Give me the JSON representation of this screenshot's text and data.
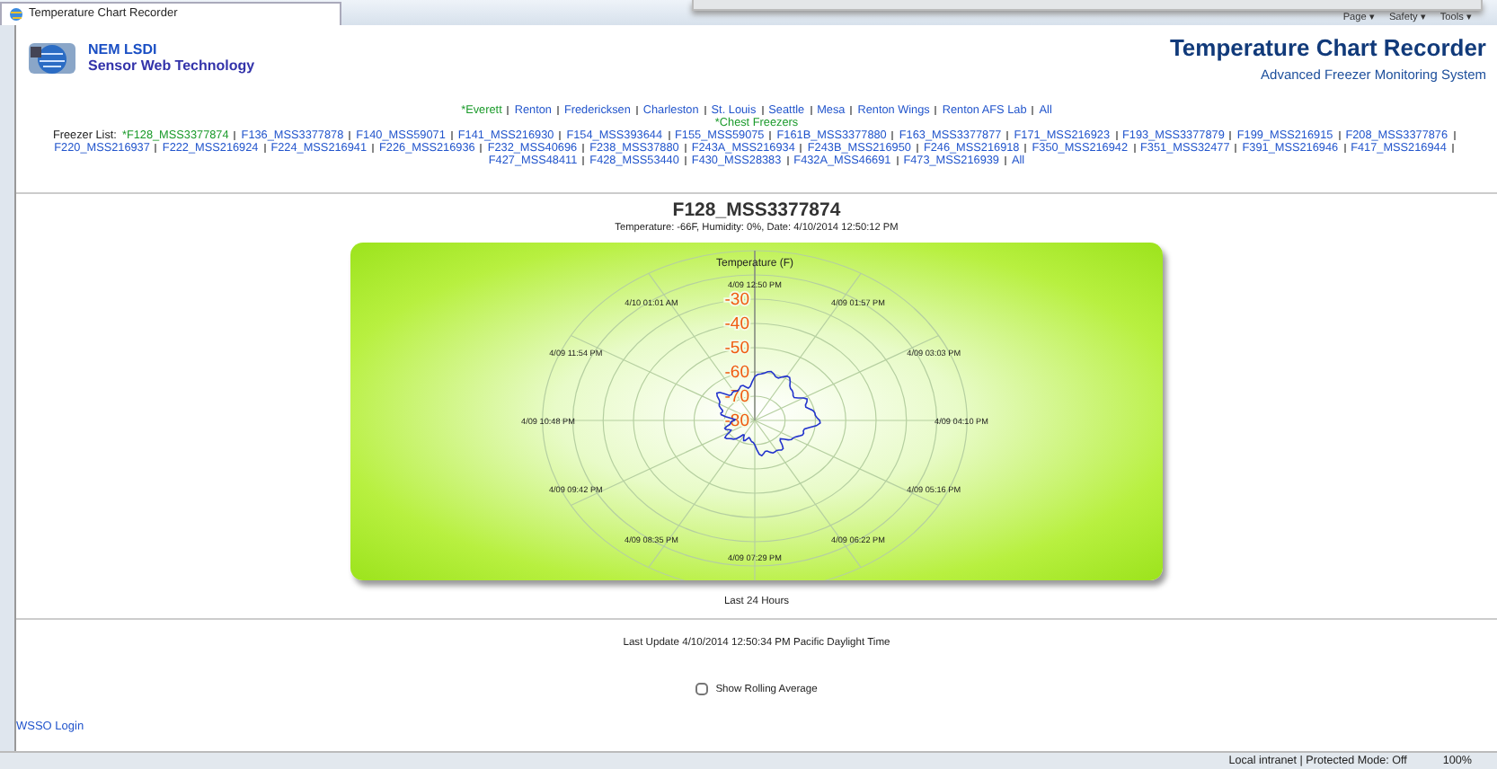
{
  "browser": {
    "tab_title": "Temperature Chart Recorder",
    "toolbar": [
      "Page ▾",
      "Safety ▾",
      "Tools ▾"
    ]
  },
  "header": {
    "brand_line_1": "NEM LSDI",
    "brand_line_2": "Sensor Web Technology",
    "title": "Temperature Chart Recorder",
    "subtitle": "Advanced Freezer Monitoring System"
  },
  "locations": [
    {
      "label": "*Everett",
      "selected": true
    },
    {
      "label": "Renton",
      "selected": false
    },
    {
      "label": "Fredericksen",
      "selected": false
    },
    {
      "label": "Charleston",
      "selected": false
    },
    {
      "label": "St. Louis",
      "selected": false
    },
    {
      "label": "Seattle",
      "selected": false
    },
    {
      "label": "Mesa",
      "selected": false
    },
    {
      "label": "Renton Wings",
      "selected": false
    },
    {
      "label": "Renton AFS Lab",
      "selected": false
    },
    {
      "label": "All",
      "selected": false
    }
  ],
  "categories": [
    {
      "label": "*Chest Freezers",
      "selected": true
    }
  ],
  "freezer_list": {
    "label": "Freezer List:",
    "items": [
      {
        "label": "*F128_MSS3377874",
        "selected": true
      },
      {
        "label": "F136_MSS3377878",
        "selected": false
      },
      {
        "label": "F140_MSS59071",
        "selected": false
      },
      {
        "label": "F141_MSS216930",
        "selected": false
      },
      {
        "label": "F154_MSS393644",
        "selected": false
      },
      {
        "label": "F155_MSS59075",
        "selected": false
      },
      {
        "label": "F161B_MSS3377880",
        "selected": false
      },
      {
        "label": "F163_MSS3377877",
        "selected": false
      },
      {
        "label": "F171_MSS216923",
        "selected": false
      },
      {
        "label": "F193_MSS3377879",
        "selected": false
      },
      {
        "label": "F199_MSS216915",
        "selected": false
      },
      {
        "label": "F208_MSS3377876",
        "selected": false
      },
      {
        "label": "F220_MSS216937",
        "selected": false
      },
      {
        "label": "F222_MSS216924",
        "selected": false
      },
      {
        "label": "F224_MSS216941",
        "selected": false
      },
      {
        "label": "F226_MSS216936",
        "selected": false
      },
      {
        "label": "F232_MSS40696",
        "selected": false
      },
      {
        "label": "F238_MSS37880",
        "selected": false
      },
      {
        "label": "F243A_MSS216934",
        "selected": false
      },
      {
        "label": "F243B_MSS216950",
        "selected": false
      },
      {
        "label": "F246_MSS216918",
        "selected": false
      },
      {
        "label": "F350_MSS216942",
        "selected": false
      },
      {
        "label": "F351_MSS32477",
        "selected": false
      },
      {
        "label": "F391_MSS216946",
        "selected": false
      },
      {
        "label": "F417_MSS216944",
        "selected": false
      },
      {
        "label": "F427_MSS48411",
        "selected": false
      },
      {
        "label": "F428_MSS53440",
        "selected": false
      },
      {
        "label": "F430_MSS28383",
        "selected": false
      },
      {
        "label": "F432A_MSS46691",
        "selected": false
      },
      {
        "label": "F473_MSS216939",
        "selected": false
      },
      {
        "label": "All",
        "selected": false
      }
    ]
  },
  "chart": {
    "title": "F128_MSS3377874",
    "subtitle": "Temperature: -66F, Humidity: 0%, Date: 4/10/2014 12:50:12 PM",
    "chart_title": "Temperature (F)",
    "ring_labels": [
      "-30",
      "-40",
      "-50",
      "-60",
      "-70",
      "-80"
    ],
    "spoke_labels": [
      "4/09 12:50 PM",
      "4/09 01:57 PM",
      "4/09 03:03 PM",
      "4/09 04:10 PM",
      "4/09 05:16 PM",
      "4/09 06:22 PM",
      "4/09 07:29 PM",
      "4/09 08:35 PM",
      "4/09 09:42 PM",
      "4/09 10:48 PM",
      "4/09 11:54 PM",
      "4/10 01:01 AM"
    ],
    "footer": "Last 24 Hours"
  },
  "last_update": "Last Update 4/10/2014 12:50:34 PM Pacific Daylight Time",
  "rolling_average": {
    "label": "Show Rolling Average",
    "checked": false
  },
  "login_link": "WSSO Login",
  "status_bar": {
    "zone": "Local intranet | Protected Mode: Off",
    "zoom": "100%"
  }
}
